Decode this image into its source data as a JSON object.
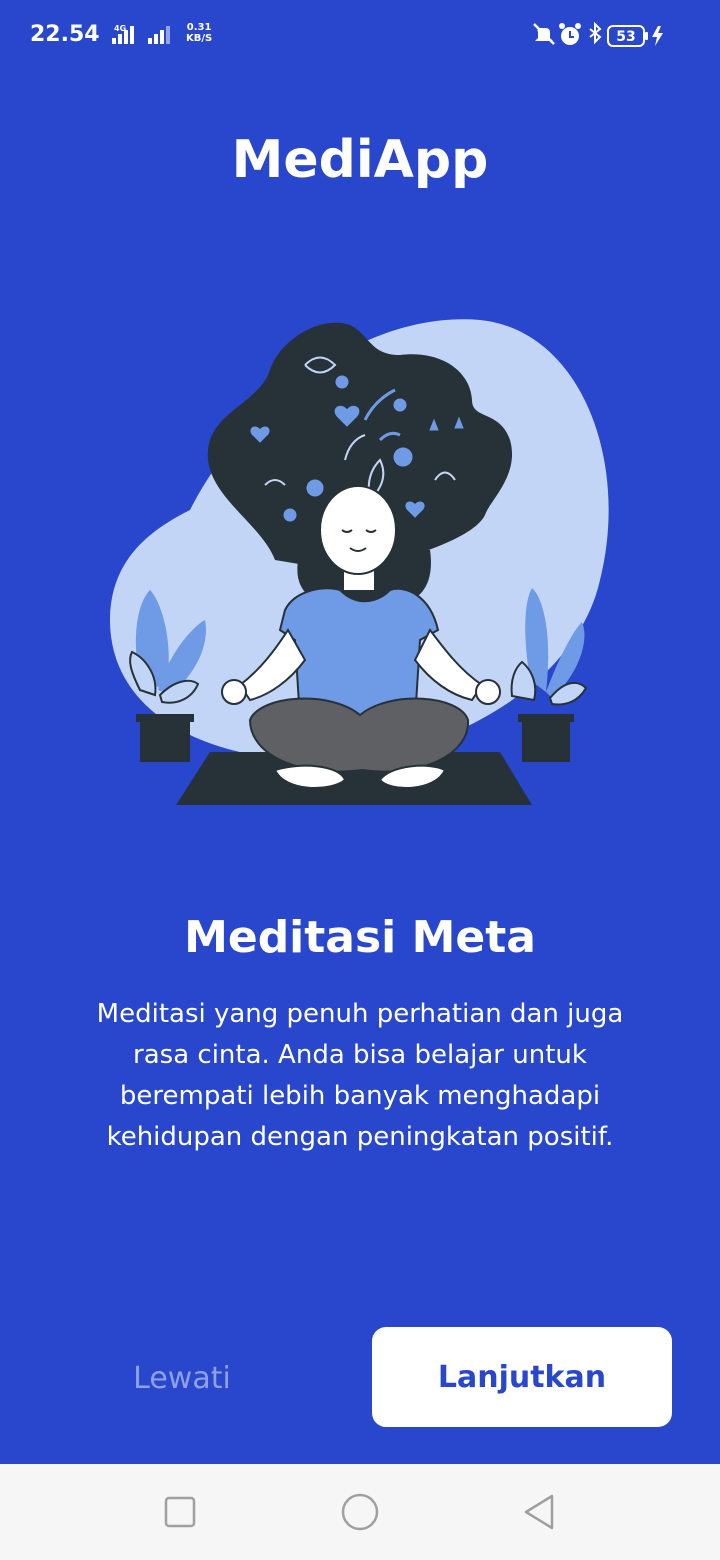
{
  "status_bar": {
    "time": "22.54",
    "network_type": "4G",
    "net_speed_value": "0.31",
    "net_speed_unit": "KB/S",
    "battery": "53",
    "icons": [
      "signal-icon",
      "signal-icon",
      "mute-vibrate-icon",
      "alarm-icon",
      "bluetooth-icon",
      "battery-icon",
      "charging-icon"
    ]
  },
  "app": {
    "title": "MediApp"
  },
  "onboarding": {
    "headline": "Meditasi Meta",
    "description": "Meditasi yang penuh perhatian dan juga rasa cinta. Anda bisa belajar untuk berempati lebih banyak menghadapi kehidupan dengan peningkatan positif."
  },
  "actions": {
    "skip_label": "Lewati",
    "next_label": "Lanjutkan"
  },
  "nav_bar": {
    "icons": [
      "recent-apps-icon",
      "home-icon",
      "back-icon"
    ]
  },
  "colors": {
    "background": "#2847cc",
    "button_text": "#2847cc",
    "skip_text": "#8ea0e6",
    "illustration_light": "#c3d5f7",
    "illustration_accent": "#6f9be6",
    "illustration_dark": "#263238"
  }
}
